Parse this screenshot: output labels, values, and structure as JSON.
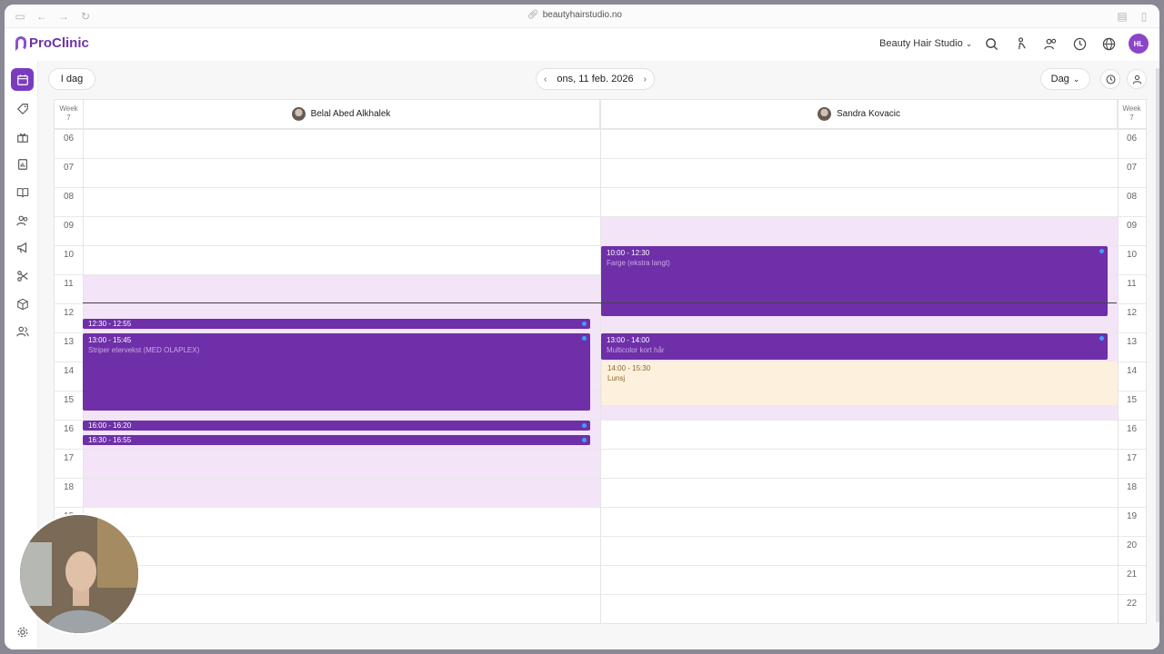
{
  "browser": {
    "url": "beautyhairstudio.no"
  },
  "header": {
    "logo": "ProClinic",
    "studio": "Beauty Hair Studio",
    "user_initials": "HL"
  },
  "toolbar": {
    "today_label": "I dag",
    "date_label": "ons, 11 feb. 2026",
    "view_label": "Dag"
  },
  "calendar": {
    "week_label": "Week",
    "week_number": "7",
    "hours": [
      "06",
      "07",
      "08",
      "09",
      "10",
      "11",
      "12",
      "13",
      "14",
      "15",
      "16",
      "17",
      "18",
      "19",
      "20",
      "21",
      "22"
    ],
    "staff": [
      {
        "name": "Belal Abed Alkhalek"
      },
      {
        "name": "Sandra Kovacic"
      }
    ],
    "events": [
      {
        "staff": 0,
        "time": "12:30 - 12:55",
        "title": "",
        "start": 12.5,
        "end": 12.917
      },
      {
        "staff": 0,
        "time": "13:00 - 15:45",
        "title": "Striper etervekst (MED OLAPLEX)",
        "start": 13.0,
        "end": 15.75
      },
      {
        "staff": 0,
        "time": "16:00 - 16:20",
        "title": "",
        "start": 16.0,
        "end": 16.333
      },
      {
        "staff": 0,
        "time": "16:30 - 16:55",
        "title": "",
        "start": 16.5,
        "end": 16.917
      },
      {
        "staff": 1,
        "time": "10:00 - 12:30",
        "title": "Farge (ekstra langt)",
        "start": 10.0,
        "end": 12.5
      },
      {
        "staff": 1,
        "time": "13:00 - 14:00",
        "title": "Multicolor kort hår",
        "start": 13.0,
        "end": 14.0
      }
    ],
    "lunch": {
      "staff": 1,
      "time": "14:00 - 15:30",
      "title": "Lunsj",
      "start": 14.0,
      "end": 15.5
    },
    "now_hour": 11.98
  },
  "colors": {
    "accent": "#7a3cbf",
    "event": "#6e2fa8",
    "availability": "#f3e4f8",
    "lunch": "#fdf0dc",
    "status_dot": "#3aa0ff"
  }
}
